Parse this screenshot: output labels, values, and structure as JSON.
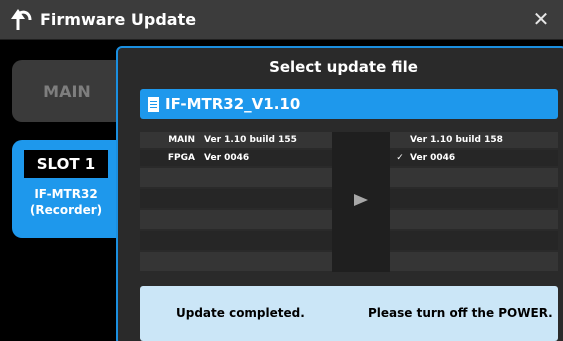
{
  "window": {
    "title": "Firmware Update",
    "back_icon": "back-arrow-icon",
    "close_icon": "close-icon",
    "close_symbol": "✕"
  },
  "sidebar": {
    "main_label": "MAIN",
    "slot_label": "SLOT 1",
    "slot_sub_line1": "IF-MTR32",
    "slot_sub_line2": "(Recorder)"
  },
  "dialog": {
    "title": "Select update file",
    "file_name": "IF-MTR32_V1.10",
    "file_icon": "file-icon",
    "current": [
      {
        "label": "MAIN",
        "value": "Ver 1.10 build 155"
      },
      {
        "label": "FPGA",
        "value": "Ver 0046"
      }
    ],
    "new": [
      {
        "check": "",
        "value": "Ver 1.10 build 158"
      },
      {
        "check": "✓",
        "value": "Ver 0046"
      }
    ],
    "arrow_icon": "right-arrow-icon",
    "message_left": "Update completed.",
    "message_right": "Please turn off the POWER."
  },
  "colors": {
    "accent": "#1e98ec",
    "message_bg": "#cbe6f7",
    "titlebar": "#3c3c3c"
  }
}
